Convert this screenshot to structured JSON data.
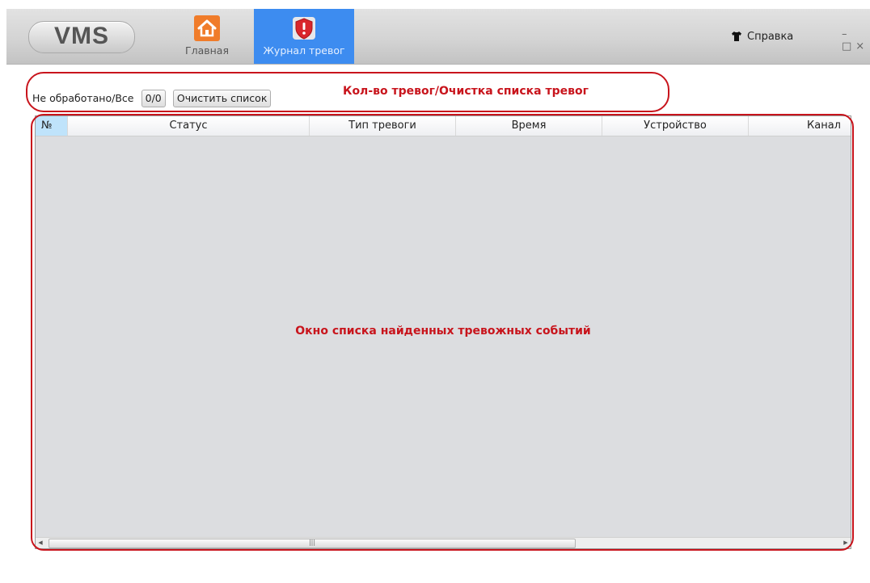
{
  "app": {
    "logo_text": "VMS",
    "nav": [
      {
        "label": "Главная",
        "icon": "home-icon",
        "active": false
      },
      {
        "label": "Журнал тревог",
        "icon": "alarm-shield-icon",
        "active": true
      }
    ],
    "help_label": "Справка",
    "help_icon": "shirt-icon",
    "window_controls": {
      "minimize": "–",
      "maximize": "□",
      "close": "×"
    }
  },
  "toolbar": {
    "counter_label": "Не обработано/Все",
    "counter_value": "0/0",
    "clear_button": "Очистить список",
    "annotation": "Кол-во тревог/Очистка списка тревог"
  },
  "table": {
    "columns": [
      "№",
      "Статус",
      "Тип тревоги",
      "Время",
      "Устройство",
      "Канал"
    ],
    "rows": [],
    "annotation": "Окно списка найденных тревожных событий",
    "scroll_thumb_label": "|||"
  },
  "colors": {
    "active_tab": "#3d8cf0",
    "home_icon": "#f07c2a",
    "alarm_icon": "#d9262c",
    "annotation": "#c8141c",
    "table_background": "#dcdde0",
    "sorted_header": "#bfe3fb"
  }
}
